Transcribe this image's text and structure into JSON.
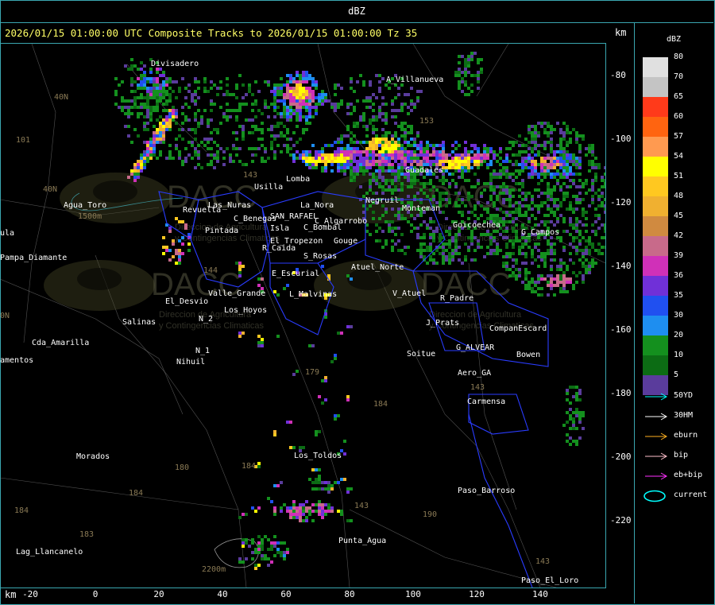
{
  "header": {
    "title": "dBZ",
    "subtitle": "2026/01/15 01:00:00 UTC Composite Tracks to 2026/01/15 01:00:00 Tz 35",
    "axis_unit_top": "km",
    "axis_unit_bottom": "km"
  },
  "axes": {
    "y_ticks": [
      "-80",
      "-100",
      "-120",
      "-140",
      "-160",
      "-180",
      "-200",
      "-220"
    ],
    "x_ticks": [
      "-20",
      "0",
      "20",
      "40",
      "60",
      "80",
      "100",
      "120",
      "140"
    ]
  },
  "legend": {
    "title": "dBZ",
    "levels": [
      {
        "label": "80",
        "color": "#e0e0e0"
      },
      {
        "label": "70",
        "color": "#c4c4c4"
      },
      {
        "label": "65",
        "color": "#ff3a1a"
      },
      {
        "label": "60",
        "color": "#ff6410"
      },
      {
        "label": "57",
        "color": "#ff9a50"
      },
      {
        "label": "54",
        "color": "#ffff00"
      },
      {
        "label": "51",
        "color": "#ffc820"
      },
      {
        "label": "48",
        "color": "#f0b030"
      },
      {
        "label": "45",
        "color": "#d08a40"
      },
      {
        "label": "42",
        "color": "#c86a8a"
      },
      {
        "label": "39",
        "color": "#d030b8"
      },
      {
        "label": "36",
        "color": "#7030d8"
      },
      {
        "label": "35",
        "color": "#2050f0"
      },
      {
        "label": "30",
        "color": "#1e8ef0"
      },
      {
        "label": "20",
        "color": "#14901e"
      },
      {
        "label": "10",
        "color": "#0c6c14"
      },
      {
        "label": "5",
        "color": "#5a3c9c"
      }
    ],
    "tracks": [
      {
        "label": "50YD",
        "color": "#00ffff"
      },
      {
        "label": "30HM",
        "color": "#ffffff"
      },
      {
        "label": "eburn",
        "color": "#ffb020"
      },
      {
        "label": "bip",
        "color": "#ffc0cb"
      },
      {
        "label": "eb+bip",
        "color": "#ff30ff"
      }
    ],
    "current_label": "current",
    "current_color": "#00ffff"
  },
  "places_white": [
    [
      "Divisadero",
      190,
      80
    ],
    [
      "A_Villanueva",
      486,
      100
    ],
    [
      "Usilla",
      320,
      235
    ],
    [
      "Lomba",
      360,
      225
    ],
    [
      "La_Nora",
      378,
      258
    ],
    [
      "Revuelta",
      230,
      264
    ],
    [
      "Las_Nuras",
      262,
      258
    ],
    [
      "C_Benegas",
      294,
      275
    ],
    [
      "SAN_RAFAEL",
      340,
      272
    ],
    [
      "C_Algarrobo",
      396,
      278
    ],
    [
      "Pintada",
      258,
      290
    ],
    [
      "Isla",
      340,
      287
    ],
    [
      "El_Tropezon",
      340,
      303
    ],
    [
      "Gouge",
      420,
      303
    ],
    [
      "C_Bombal",
      382,
      286
    ],
    [
      "R_Caida",
      330,
      312
    ],
    [
      "S_Rosas",
      382,
      322
    ],
    [
      "Atuel_Norte",
      442,
      336
    ],
    [
      "E_Escurial",
      342,
      344
    ],
    [
      "Valle_Grande",
      262,
      369
    ],
    [
      "L_Malvinas",
      364,
      370
    ],
    [
      "El_Desvio",
      208,
      379
    ],
    [
      "V_Atuel",
      494,
      369
    ],
    [
      "R_Padre",
      554,
      375
    ],
    [
      "N_2",
      250,
      401
    ],
    [
      "J_Prats",
      536,
      406
    ],
    [
      "Salinas",
      154,
      405
    ],
    [
      "CompanEscard",
      616,
      413
    ],
    [
      "Cda_Amarilla",
      40,
      431
    ],
    [
      "G_ALVEAR",
      574,
      437
    ],
    [
      "N_1",
      246,
      441
    ],
    [
      "Soitue",
      512,
      445
    ],
    [
      "Bowen",
      650,
      446
    ],
    [
      "amentos",
      0,
      453
    ],
    [
      "Nihuil",
      222,
      455
    ],
    [
      "Aero_GA",
      576,
      469
    ],
    [
      "Carmensa",
      588,
      505
    ],
    [
      "Morados",
      96,
      574
    ],
    [
      "Los_Toldos",
      370,
      573
    ],
    [
      "Paso_Barroso",
      576,
      617
    ],
    [
      "Punta_Agua",
      426,
      680
    ],
    [
      "Lag_Llancanelo",
      20,
      694
    ],
    [
      "Paso_El_Loro",
      656,
      730
    ],
    [
      "Agua_Toro",
      80,
      258
    ],
    [
      "ula",
      0,
      293
    ],
    [
      "Pampa_Diamante",
      0,
      324
    ],
    [
      "G_Campos",
      656,
      292
    ],
    [
      "Goicoechea",
      570,
      283
    ],
    [
      "Guadales",
      510,
      214
    ],
    [
      "Monteman",
      506,
      262
    ],
    [
      "Negruil",
      460,
      252
    ],
    [
      "Los_Hoyos",
      282,
      390
    ]
  ],
  "grid_numbers": [
    [
      "40N",
      68,
      122
    ],
    [
      "101",
      20,
      176
    ],
    [
      "40N",
      54,
      238
    ],
    [
      "153",
      528,
      152
    ],
    [
      "143",
      306,
      220
    ],
    [
      "144",
      256,
      340
    ],
    [
      "179",
      384,
      468
    ],
    [
      "184",
      470,
      508
    ],
    [
      "180",
      220,
      588
    ],
    [
      "184",
      162,
      620
    ],
    [
      "184",
      304,
      586
    ],
    [
      "184",
      18,
      642
    ],
    [
      "183",
      100,
      672
    ],
    [
      "143",
      592,
      487
    ],
    [
      "190",
      532,
      647
    ],
    [
      "143",
      446,
      636
    ],
    [
      "143",
      674,
      706
    ],
    [
      "2200m",
      254,
      716
    ],
    [
      "1500m",
      98,
      272
    ],
    [
      "0N",
      0,
      397
    ]
  ],
  "watermark": {
    "logo": "DACC",
    "org_line1": "Direccion de Agricultura",
    "org_line2": "y Contingencias Climaticas"
  }
}
